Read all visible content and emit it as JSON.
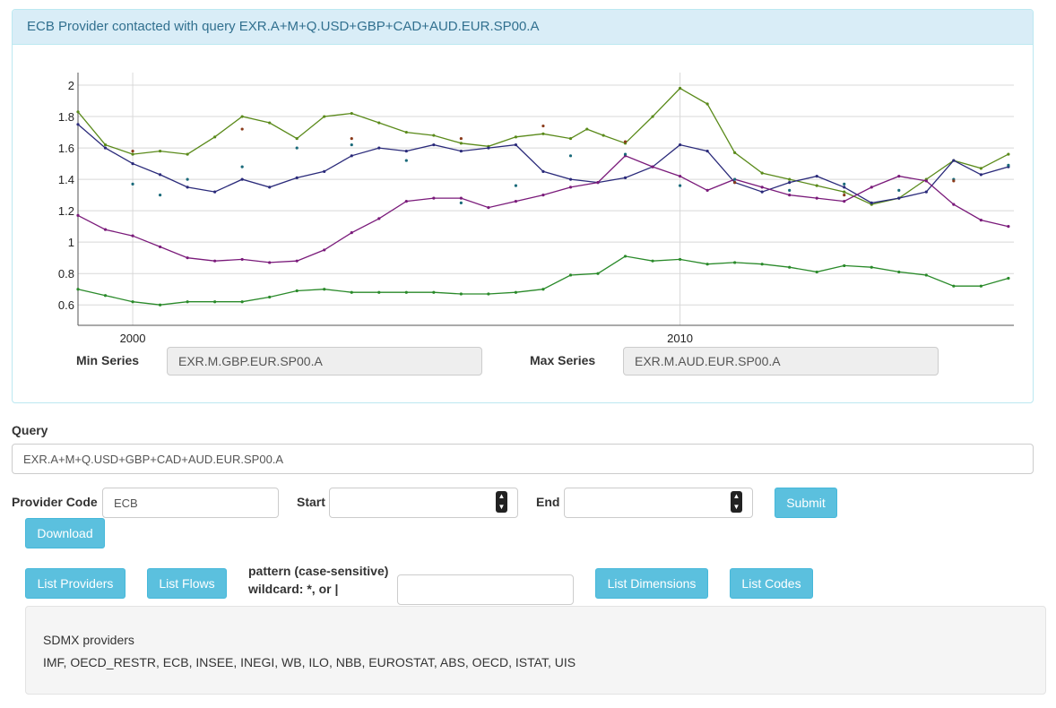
{
  "alert": {
    "text": "ECB Provider contacted with query EXR.A+M+Q.USD+GBP+CAD+AUD.EUR.SP00.A"
  },
  "chart_data": {
    "type": "line",
    "title": "",
    "xlabel": "",
    "ylabel": "",
    "x_ticks": [
      "2000",
      "2010"
    ],
    "y_ticks": [
      "0.6",
      "0.8",
      "1",
      "1.2",
      "1.4",
      "1.6",
      "1.8",
      "2"
    ],
    "xlim": [
      1999.0,
      2016.1
    ],
    "ylim": [
      0.47,
      2.08
    ],
    "grid": true,
    "series": [
      {
        "color": "#5a8a1a",
        "x": [
          1999.0,
          1999.5,
          2000.0,
          2000.5,
          2001.0,
          2001.5,
          2002.0,
          2002.5,
          2003.0,
          2003.5,
          2004.0,
          2004.5,
          2005.0,
          2005.5,
          2006.0,
          2006.5,
          2007.0,
          2007.5,
          2008.0,
          2008.3,
          2008.6,
          2009.0,
          2009.5,
          2010.0,
          2010.5,
          2011.0,
          2011.5,
          2012.0,
          2012.5,
          2013.0,
          2013.5,
          2014.0,
          2014.5,
          2015.0,
          2015.5,
          2016.0
        ],
        "values": [
          1.83,
          1.62,
          1.56,
          1.58,
          1.56,
          1.67,
          1.8,
          1.76,
          1.66,
          1.8,
          1.82,
          1.76,
          1.7,
          1.68,
          1.63,
          1.61,
          1.67,
          1.69,
          1.66,
          1.72,
          1.68,
          1.63,
          1.8,
          1.98,
          1.88,
          1.57,
          1.44,
          1.4,
          1.36,
          1.32,
          1.24,
          1.28,
          1.4,
          1.52,
          1.47,
          1.56
        ]
      },
      {
        "color": "#2a2a7a",
        "x": [
          1999.0,
          1999.5,
          2000.0,
          2000.5,
          2001.0,
          2001.5,
          2002.0,
          2002.5,
          2003.0,
          2003.5,
          2004.0,
          2004.5,
          2005.0,
          2005.5,
          2006.0,
          2006.5,
          2007.0,
          2007.5,
          2008.0,
          2008.5,
          2009.0,
          2009.5,
          2010.0,
          2010.5,
          2011.0,
          2011.5,
          2012.0,
          2012.5,
          2013.0,
          2013.5,
          2014.0,
          2014.5,
          2015.0,
          2015.5,
          2016.0
        ],
        "values": [
          1.75,
          1.6,
          1.5,
          1.43,
          1.35,
          1.32,
          1.4,
          1.35,
          1.41,
          1.45,
          1.55,
          1.6,
          1.58,
          1.62,
          1.58,
          1.6,
          1.62,
          1.45,
          1.4,
          1.38,
          1.41,
          1.48,
          1.62,
          1.58,
          1.38,
          1.32,
          1.38,
          1.42,
          1.35,
          1.25,
          1.28,
          1.32,
          1.52,
          1.43,
          1.48
        ]
      },
      {
        "color": "#7a1a7a",
        "x": [
          1999.0,
          1999.5,
          2000.0,
          2000.5,
          2001.0,
          2001.5,
          2002.0,
          2002.5,
          2003.0,
          2003.5,
          2004.0,
          2004.5,
          2005.0,
          2005.5,
          2006.0,
          2006.5,
          2007.0,
          2007.5,
          2008.0,
          2008.5,
          2009.0,
          2009.5,
          2010.0,
          2010.5,
          2011.0,
          2011.5,
          2012.0,
          2012.5,
          2013.0,
          2013.5,
          2014.0,
          2014.5,
          2015.0,
          2015.5,
          2016.0
        ],
        "values": [
          1.17,
          1.08,
          1.04,
          0.97,
          0.9,
          0.88,
          0.89,
          0.87,
          0.88,
          0.95,
          1.06,
          1.15,
          1.26,
          1.28,
          1.28,
          1.22,
          1.26,
          1.3,
          1.35,
          1.38,
          1.55,
          1.48,
          1.42,
          1.33,
          1.4,
          1.35,
          1.3,
          1.28,
          1.26,
          1.35,
          1.42,
          1.39,
          1.24,
          1.14,
          1.1
        ]
      },
      {
        "color": "#2a8a2a",
        "x": [
          1999.0,
          1999.5,
          2000.0,
          2000.5,
          2001.0,
          2001.5,
          2002.0,
          2002.5,
          2003.0,
          2003.5,
          2004.0,
          2004.5,
          2005.0,
          2005.5,
          2006.0,
          2006.5,
          2007.0,
          2007.5,
          2008.0,
          2008.5,
          2009.0,
          2009.5,
          2010.0,
          2010.5,
          2011.0,
          2011.5,
          2012.0,
          2012.5,
          2013.0,
          2013.5,
          2014.0,
          2014.5,
          2015.0,
          2015.5,
          2016.0
        ],
        "values": [
          0.7,
          0.66,
          0.62,
          0.6,
          0.62,
          0.62,
          0.62,
          0.65,
          0.69,
          0.7,
          0.68,
          0.68,
          0.68,
          0.68,
          0.67,
          0.67,
          0.68,
          0.7,
          0.79,
          0.8,
          0.91,
          0.88,
          0.89,
          0.86,
          0.87,
          0.86,
          0.84,
          0.81,
          0.85,
          0.84,
          0.81,
          0.79,
          0.72,
          0.72,
          0.77
        ]
      }
    ],
    "marker_series": [
      {
        "color": "#1a6a7a",
        "x": [
          2000.0,
          2000.5,
          2001.0,
          2002.0,
          2003.0,
          2004.0,
          2005.0,
          2006.0,
          2007.0,
          2008.0,
          2009.0,
          2010.0,
          2011.0,
          2012.0,
          2013.0,
          2014.0,
          2015.0,
          2016.0
        ],
        "values": [
          1.37,
          1.3,
          1.4,
          1.48,
          1.6,
          1.62,
          1.52,
          1.25,
          1.36,
          1.55,
          1.56,
          1.36,
          1.4,
          1.33,
          1.37,
          1.33,
          1.4,
          1.49
        ]
      },
      {
        "color": "#8a3a1a",
        "x": [
          2000.0,
          2002.0,
          2004.0,
          2006.0,
          2007.5,
          2009.0,
          2011.0,
          2013.0,
          2015.0
        ],
        "values": [
          1.58,
          1.72,
          1.66,
          1.66,
          1.74,
          1.64,
          1.38,
          1.3,
          1.39
        ]
      }
    ]
  },
  "minmax": {
    "min_label": "Min Series",
    "min_value": "EXR.M.GBP.EUR.SP00.A",
    "max_label": "Max Series",
    "max_value": "EXR.M.AUD.EUR.SP00.A"
  },
  "query": {
    "label": "Query",
    "value": "EXR.A+M+Q.USD+GBP+CAD+AUD.EUR.SP00.A"
  },
  "form": {
    "provider_label": "Provider Code",
    "provider_value": "ECB",
    "start_label": "Start",
    "start_value": "",
    "end_label": "End",
    "end_value": "",
    "submit_label": "Submit",
    "download_label": "Download"
  },
  "tools": {
    "list_providers": "List Providers",
    "list_flows": "List Flows",
    "pattern_label_1": "pattern (case-sensitive)",
    "pattern_label_2": "wildcard: *, or |",
    "pattern_value": "",
    "list_dimensions": "List Dimensions",
    "list_codes": "List Codes"
  },
  "output": {
    "title": "SDMX providers",
    "text": "IMF, OECD_RESTR, ECB, INSEE, INEGI, WB, ILO, NBB, EUROSTAT, ABS, OECD, ISTAT, UIS"
  }
}
